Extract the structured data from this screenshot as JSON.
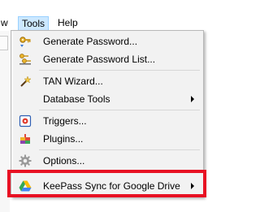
{
  "menubar": {
    "clipped_item": "w",
    "tools": "Tools",
    "help": "Help"
  },
  "menu": {
    "items": [
      {
        "label": "Generate Password...",
        "icon": "key-generate-icon"
      },
      {
        "label": "Generate Password List...",
        "icon": "key-list-icon"
      },
      {
        "label": "TAN Wizard...",
        "icon": "magic-wand-icon"
      },
      {
        "label": "Database Tools",
        "icon": "",
        "submenu": true
      },
      {
        "label": "Triggers...",
        "icon": "triggers-icon"
      },
      {
        "label": "Plugins...",
        "icon": "plugins-icon"
      },
      {
        "label": "Options...",
        "icon": "gear-icon"
      },
      {
        "label": "KeePass Sync for Google Drive",
        "icon": "google-drive-icon",
        "submenu": true
      }
    ]
  },
  "colors": {
    "highlight_border": "#e81123",
    "menu_background": "#f2f2f2",
    "menubar_selected": "#cce8ff"
  }
}
